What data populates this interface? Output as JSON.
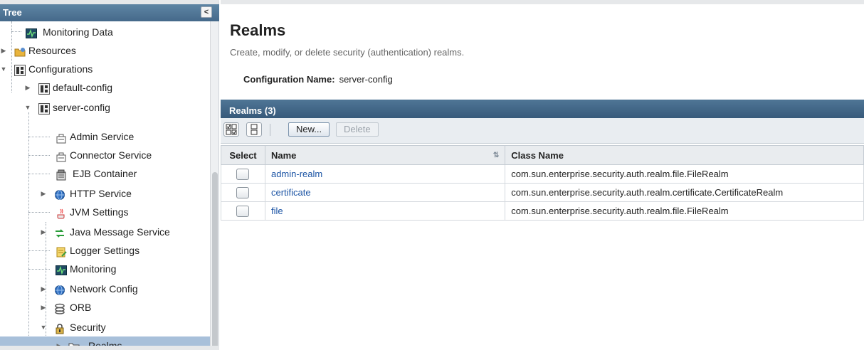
{
  "tree": {
    "header": "Tree",
    "collapse_glyph": "<",
    "items": [
      {
        "label": "Monitoring Data",
        "icon": "monitor-icon"
      },
      {
        "label": "Resources",
        "icon": "resources-icon"
      },
      {
        "label": "Configurations",
        "icon": "config-icon"
      },
      {
        "label": "default-config",
        "icon": "config-icon"
      },
      {
        "label": "server-config",
        "icon": "config-icon"
      },
      {
        "label": "Admin Service",
        "icon": "service-icon"
      },
      {
        "label": "Connector Service",
        "icon": "service-icon"
      },
      {
        "label": "EJB Container",
        "icon": "ejb-container-icon"
      },
      {
        "label": "HTTP Service",
        "icon": "globe-icon"
      },
      {
        "label": "JVM Settings",
        "icon": "java-icon"
      },
      {
        "label": "Java Message Service",
        "icon": "messaging-icon"
      },
      {
        "label": "Logger Settings",
        "icon": "logger-icon"
      },
      {
        "label": "Monitoring",
        "icon": "monitor-icon"
      },
      {
        "label": "Network Config",
        "icon": "globe-icon"
      },
      {
        "label": "ORB",
        "icon": "orb-icon"
      },
      {
        "label": "Security",
        "icon": "lock-icon"
      },
      {
        "label": "Realms",
        "icon": "folder-icon"
      }
    ]
  },
  "page": {
    "title": "Realms",
    "description": "Create, modify, or delete security (authentication) realms.",
    "config_label": "Configuration Name:",
    "config_value": "server-config"
  },
  "table": {
    "title": "Realms (3)",
    "toolbar": {
      "select_all_glyph": "☑",
      "deselect_all_glyph": "☐",
      "new_label": "New...",
      "delete_label": "Delete"
    },
    "columns": {
      "select": "Select",
      "name": "Name",
      "class_name": "Class Name",
      "sort_glyph": "⇅"
    },
    "rows": [
      {
        "name": "admin-realm",
        "class_name": "com.sun.enterprise.security.auth.realm.file.FileRealm"
      },
      {
        "name": "certificate",
        "class_name": "com.sun.enterprise.security.auth.realm.certificate.CertificateRealm"
      },
      {
        "name": "file",
        "class_name": "com.sun.enterprise.security.auth.realm.file.FileRealm"
      }
    ]
  },
  "colors": {
    "header_bar": "#45698a",
    "selection": "#a8c0da",
    "link": "#1d55a5"
  }
}
